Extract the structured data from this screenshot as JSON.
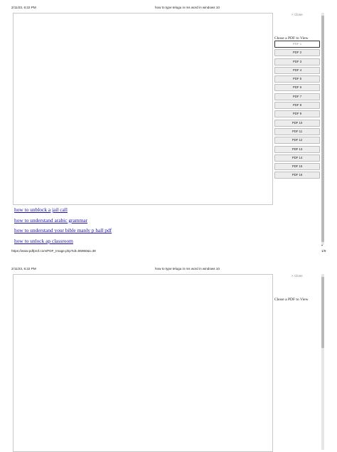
{
  "page1": {
    "header": {
      "timestamp": "2/11/23, 6:22 PM",
      "title": "how to type telugu in ms word in windows 10"
    },
    "close_label": "× Close",
    "panel_title": "Chose a PDF to View",
    "pdf_buttons": [
      "PDF 1",
      "PDF 2",
      "PDF 3",
      "PDF 4",
      "PDF 5",
      "PDF 6",
      "PDF 7",
      "PDF 8",
      "PDF 9",
      "PDF 10",
      "PDF 11",
      "PDF 12",
      "PDF 13",
      "PDF 14",
      "PDF 15",
      "PDF 16"
    ],
    "links": [
      "how to unblock a jail call",
      "how to understand arabic grammar",
      "how to understand your bible manly p hall pdf",
      "how to unlock ap classroom"
    ],
    "footer": {
      "url": "https://www.pdfprof.com/PDF_Image.php?idt=85960&t=39",
      "page": "1/9"
    }
  },
  "page2": {
    "header": {
      "timestamp": "2/11/23, 6:22 PM",
      "title": "how to type telugu in ms word in windows 10"
    },
    "close_label": "× Close",
    "panel_title": "Chose a PDF to View"
  }
}
